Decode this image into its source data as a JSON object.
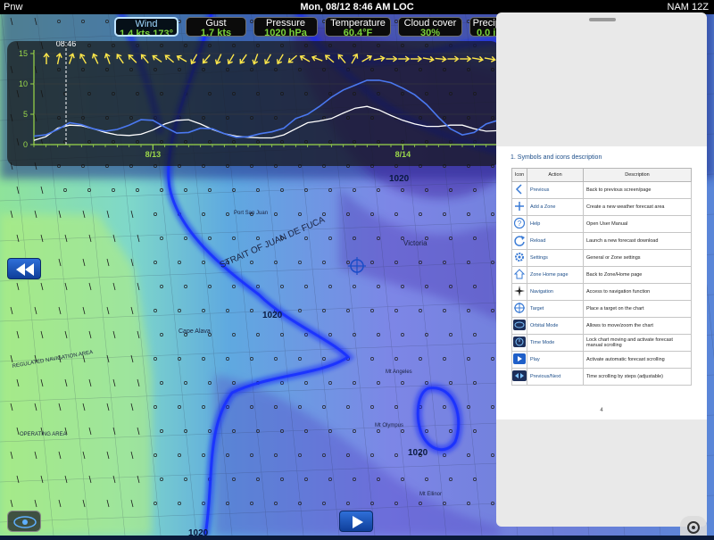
{
  "status_bar": {
    "left_label": "Pnw",
    "center_label": "Mon, 08/12 8:46 AM LOC",
    "right_label": "NAM 12Z"
  },
  "weather_pills": [
    {
      "label": "Wind",
      "value": "1.4 kts 173°",
      "active": true
    },
    {
      "label": "Gust",
      "value": "1.7 kts",
      "active": false
    },
    {
      "label": "Pressure",
      "value": "1020 hPa",
      "active": false
    },
    {
      "label": "Temperature",
      "value": "60.4°F",
      "active": false
    },
    {
      "label": "Cloud cover",
      "value": "30%",
      "active": false
    },
    {
      "label": "Precipit",
      "value": "0.0 in",
      "active": false
    }
  ],
  "graph": {
    "current_time_label": "08:46",
    "y_ticks": [
      0,
      5,
      10,
      15
    ],
    "date_labels": [
      "8/13",
      "8/14"
    ],
    "colors": {
      "wind": "#4a78f0",
      "gust": "#ffffff",
      "axis": "#9bd84a"
    },
    "wind_series": [
      1.4,
      1.6,
      2.5,
      3.6,
      3.3,
      2.6,
      2.2,
      2.5,
      3.2,
      4.1,
      4.0,
      2.9,
      1.9,
      2.0,
      2.7,
      2.6,
      1.8,
      1.2,
      1.3,
      1.8,
      2.1,
      2.7,
      4.3,
      5.0,
      6.3,
      7.8,
      9.0,
      9.8,
      10.6,
      10.6,
      10.2,
      9.3,
      8.2,
      6.6,
      4.5,
      2.6,
      1.6,
      2.0,
      3.4,
      4.0
    ],
    "gust_series": [
      0.7,
      1.3,
      2.7,
      3.2,
      3.1,
      2.6,
      2.0,
      1.6,
      1.5,
      1.7,
      2.4,
      3.4,
      4.0,
      4.1,
      3.4,
      2.5,
      1.8,
      1.4,
      1.2,
      1.1,
      1.1,
      1.6,
      2.6,
      3.6,
      3.9,
      4.3,
      5.2,
      6.0,
      6.3,
      5.7,
      4.8,
      4.0,
      3.4,
      3.0,
      3.0,
      3.2,
      3.2,
      2.6,
      2.2,
      2.3
    ]
  },
  "map": {
    "pressure_labels": [
      "1020",
      "1020",
      "1020",
      "1020"
    ],
    "place_labels": [
      "STRAIT OF JUAN DE FUCA",
      "Victoria",
      "Cape Alava",
      "Mt Olympus",
      "Mt Angeles",
      "Mt Ellinor",
      "Port San Juan",
      "OPERATING AREA",
      "REGULATED NAVIGATION AREA"
    ]
  },
  "legend_doc": {
    "title": "1. Symbols and icons description",
    "headers": {
      "icon": "Icon",
      "action": "Action",
      "description": "Description"
    },
    "rows": [
      {
        "icon": "chevron-left-icon",
        "action": "Previous",
        "description": "Back to previous screen/page"
      },
      {
        "icon": "plus-icon",
        "action": "Add a Zone",
        "description": "Create a new weather forecast area"
      },
      {
        "icon": "help-icon",
        "action": "Help",
        "description": "Open User Manual"
      },
      {
        "icon": "reload-icon",
        "action": "Reload",
        "description": "Launch a new forecast download"
      },
      {
        "icon": "gear-icon",
        "action": "Settings",
        "description": "General or Zone settings"
      },
      {
        "icon": "home-icon",
        "action": "Zone Home page",
        "description": "Back to Zone/Home page"
      },
      {
        "icon": "compass-icon",
        "action": "Navigation",
        "description": "Access to navigation function"
      },
      {
        "icon": "target-icon",
        "action": "Target",
        "description": "Place a target on the chart"
      },
      {
        "icon": "orbital-icon",
        "action": "Orbital Mode",
        "description": "Allows to move/zoom the chart"
      },
      {
        "icon": "clock-icon",
        "action": "Time Mode",
        "description": "Lock chart moving and activate forecast manual scrolling"
      },
      {
        "icon": "play-icon",
        "action": "Play",
        "description": "Activate automatic forecast scrolling"
      },
      {
        "icon": "previous-next-icon",
        "action": "Previous/Next",
        "description": "Time scrolling by steps (adjustable)"
      }
    ],
    "footer": "4"
  }
}
